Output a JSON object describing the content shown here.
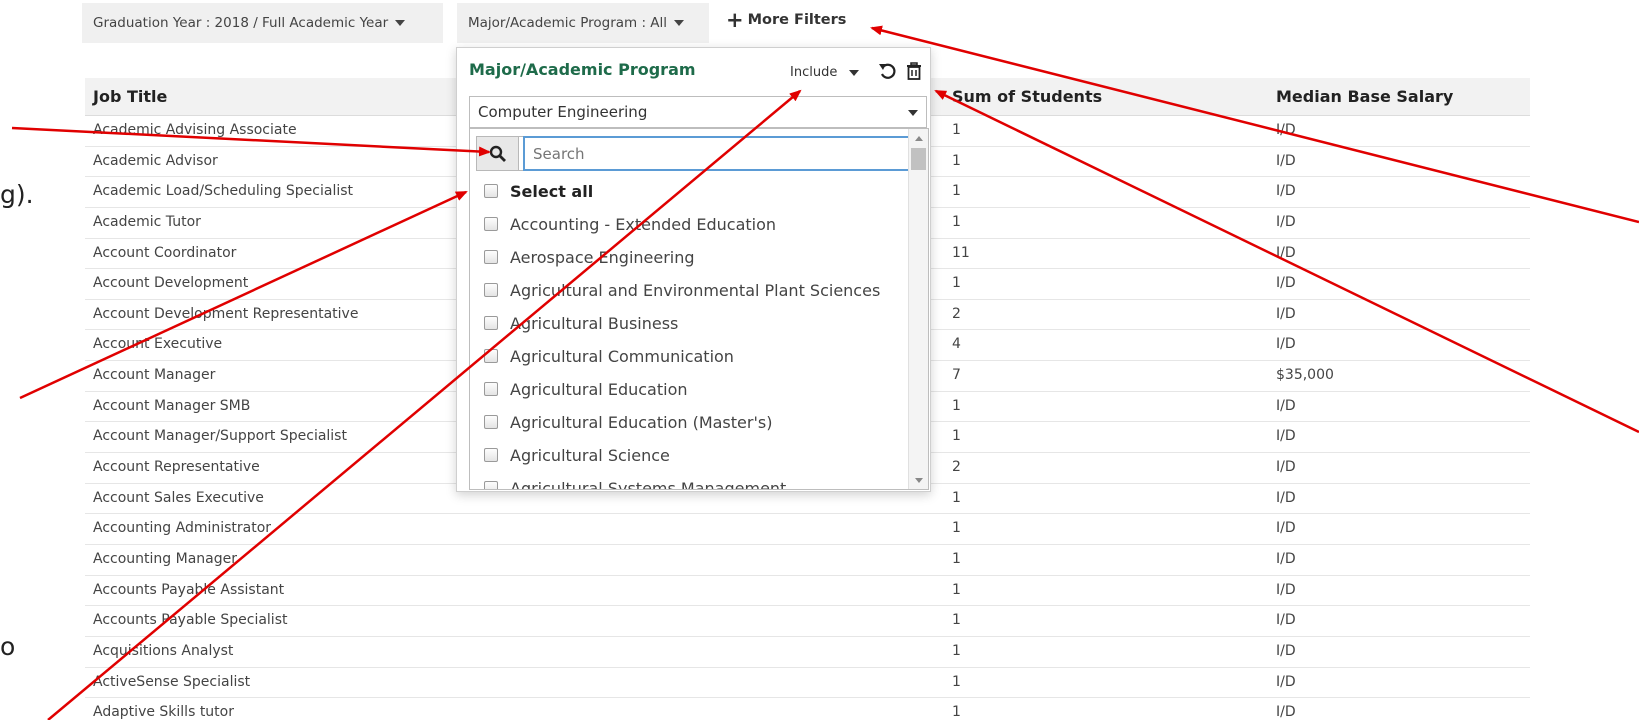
{
  "filters": {
    "graduation_year": "Graduation Year : 2018 / Full Academic Year",
    "major": "Major/Academic Program : All",
    "more_filters": "More Filters"
  },
  "table": {
    "headers": [
      "Job Title",
      "Sum of Students",
      "Median Base Salary"
    ],
    "rows": [
      [
        "Academic Advising Associate",
        "1",
        "I/D"
      ],
      [
        "Academic Advisor",
        "1",
        "I/D"
      ],
      [
        "Academic Load/Scheduling Specialist",
        "1",
        "I/D"
      ],
      [
        "Academic Tutor",
        "1",
        "I/D"
      ],
      [
        "Account Coordinator",
        "11",
        "I/D"
      ],
      [
        "Account Development",
        "1",
        "I/D"
      ],
      [
        "Account Development Representative",
        "2",
        "I/D"
      ],
      [
        "Account Executive",
        "4",
        "I/D"
      ],
      [
        "Account Manager",
        "7",
        "$35,000"
      ],
      [
        "Account Manager SMB",
        "1",
        "I/D"
      ],
      [
        "Account Manager/Support Specialist",
        "1",
        "I/D"
      ],
      [
        "Account Representative",
        "2",
        "I/D"
      ],
      [
        "Account Sales Executive",
        "1",
        "I/D"
      ],
      [
        "Accounting Administrator",
        "1",
        "I/D"
      ],
      [
        "Accounting Manager",
        "1",
        "I/D"
      ],
      [
        "Accounts Payable Assistant",
        "1",
        "I/D"
      ],
      [
        "Accounts Payable Specialist",
        "1",
        "I/D"
      ],
      [
        "Acquisitions Analyst",
        "1",
        "I/D"
      ],
      [
        "ActiveSense Specialist",
        "1",
        "I/D"
      ],
      [
        "Adaptive Skills tutor",
        "1",
        "I/D"
      ]
    ]
  },
  "popup": {
    "title": "Major/Academic Program",
    "include_label": "Include",
    "selected_value": "Computer Engineering",
    "search_placeholder": "Search",
    "select_all": "Select all",
    "options": [
      "Accounting - Extended Education",
      "Aerospace Engineering",
      "Agricultural and Environmental Plant Sciences",
      "Agricultural Business",
      "Agricultural Communication",
      "Agricultural Education",
      "Agricultural Education (Master's)",
      "Agricultural Science",
      "Agricultural Systems Management"
    ]
  },
  "left_fragments": {
    "fragment_1": "g).",
    "fragment_2": "o"
  },
  "colors": {
    "accent_green": "#1e6b4a",
    "annotation_arrow": "#e00000",
    "search_focus": "#5b9bd5"
  }
}
